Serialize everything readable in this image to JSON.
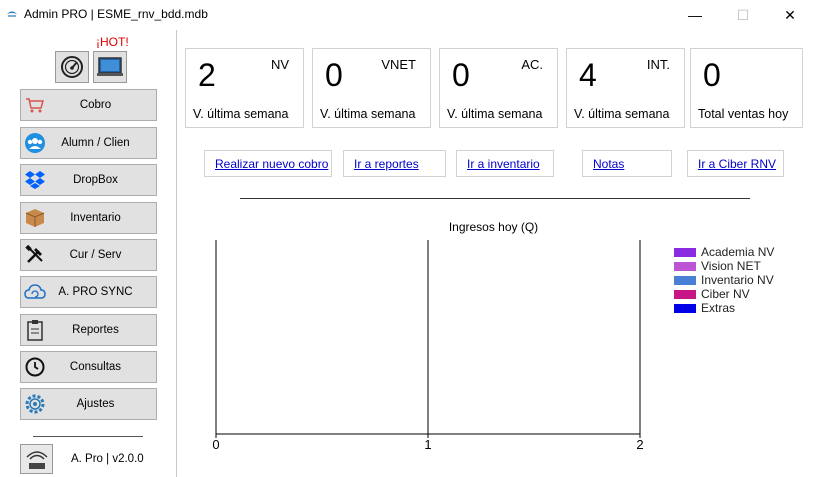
{
  "window": {
    "title": "Admin PRO | ESME_rnv_bdd.mdb",
    "minimize": "—",
    "maximize": "☐",
    "close": "✕"
  },
  "sidebar": {
    "hot_label": "¡HOT!",
    "items": [
      {
        "label": "Cobro",
        "icon": "cart-icon"
      },
      {
        "label": "Alumn / Clien",
        "icon": "users-icon"
      },
      {
        "label": "DropBox",
        "icon": "dropbox-icon"
      },
      {
        "label": "Inventario",
        "icon": "box-icon"
      },
      {
        "label": "Cur / Serv",
        "icon": "tools-icon"
      },
      {
        "label": "A. PRO SYNC",
        "icon": "cloud-sync-icon"
      },
      {
        "label": "Reportes",
        "icon": "clipboard-icon"
      },
      {
        "label": "Consultas",
        "icon": "clock-icon"
      },
      {
        "label": "Ajustes",
        "icon": "gear-icon"
      }
    ],
    "version": "A. Pro | v2.0.0"
  },
  "cards": [
    {
      "value": "2",
      "tag": "NV",
      "caption": "V. última semana"
    },
    {
      "value": "0",
      "tag": "VNET",
      "caption": "V. última semana"
    },
    {
      "value": "0",
      "tag": "AC.",
      "caption": "V. última semana"
    },
    {
      "value": "4",
      "tag": "INT.",
      "caption": "V. última semana"
    },
    {
      "value": "0",
      "tag": "",
      "caption": "Total ventas hoy"
    }
  ],
  "links": [
    "Realizar nuevo cobro",
    "Ir a reportes",
    "Ir a inventario",
    "Notas",
    "Ir a Ciber RNV"
  ],
  "chart_data": {
    "type": "bar",
    "title": "Ingresos hoy (Q)",
    "xlim": [
      0,
      2
    ],
    "xticks": [
      "0",
      "1",
      "2"
    ],
    "series": [
      {
        "name": "Academia NV",
        "color": "#8a2be2",
        "values": []
      },
      {
        "name": "Vision NET",
        "color": "#ba55d3",
        "values": []
      },
      {
        "name": "Inventario NV",
        "color": "#4a7fd6",
        "values": []
      },
      {
        "name": "Ciber NV",
        "color": "#c71585",
        "values": []
      },
      {
        "name": "Extras",
        "color": "#0000e6",
        "values": []
      }
    ],
    "legend": "top-right",
    "grid": false
  }
}
